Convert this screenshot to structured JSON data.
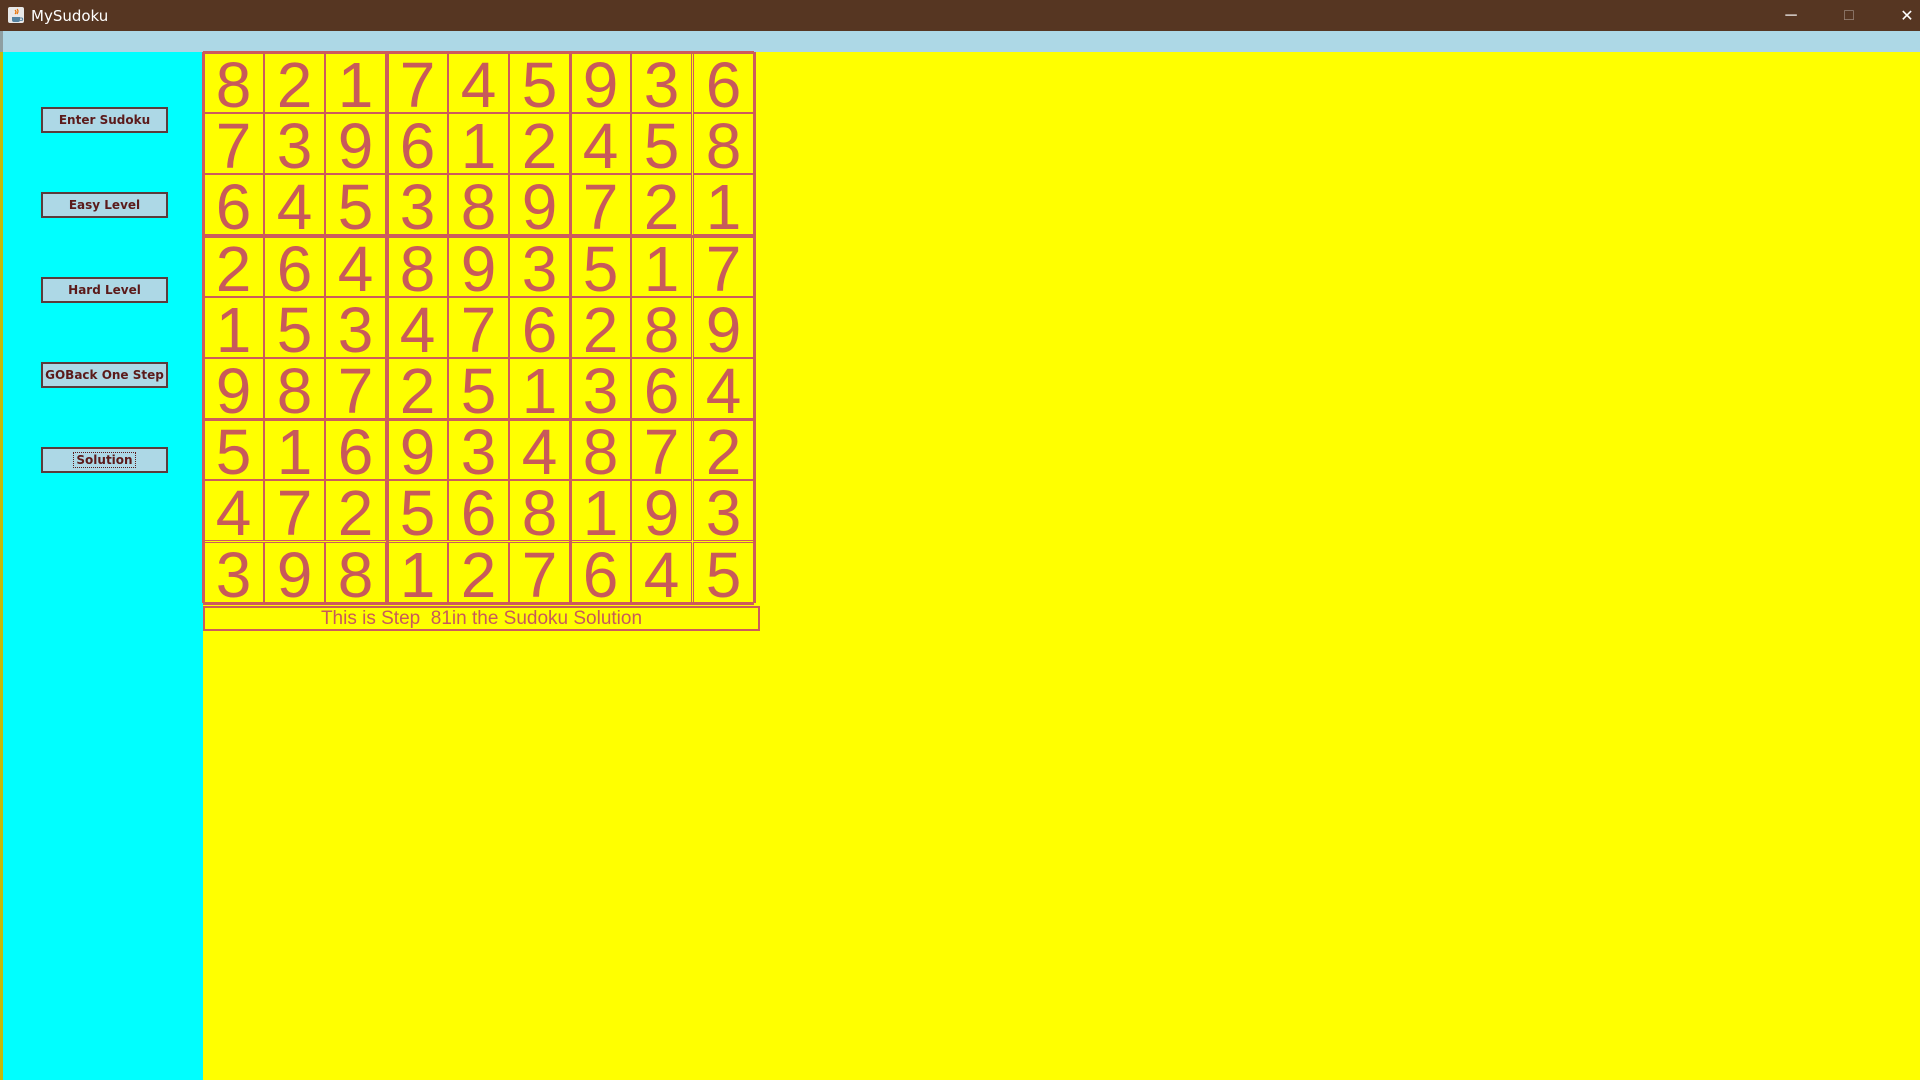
{
  "window": {
    "title": "MySudoku",
    "minimize_glyph": "─",
    "maximize_glyph": "□",
    "close_glyph": "✕",
    "titlebar_color": "#563622",
    "menubar_color": "#add8e6"
  },
  "sidebar": {
    "background": "#00ffff",
    "buttons": [
      {
        "label": "Enter Sudoku"
      },
      {
        "label": "Easy Level"
      },
      {
        "label": "Hard Level"
      },
      {
        "label": "GOBack One Step"
      },
      {
        "label": "Solution"
      }
    ]
  },
  "board": {
    "background": "#ffff00",
    "digit_color": "#c85a5a",
    "rows": [
      [
        "8",
        "2",
        "1",
        "7",
        "4",
        "5",
        "9",
        "3",
        "6"
      ],
      [
        "7",
        "3",
        "9",
        "6",
        "1",
        "2",
        "4",
        "5",
        "8"
      ],
      [
        "6",
        "4",
        "5",
        "3",
        "8",
        "9",
        "7",
        "2",
        "1"
      ],
      [
        "2",
        "6",
        "4",
        "8",
        "9",
        "3",
        "5",
        "1",
        "7"
      ],
      [
        "1",
        "5",
        "3",
        "4",
        "7",
        "6",
        "2",
        "8",
        "9"
      ],
      [
        "9",
        "8",
        "7",
        "2",
        "5",
        "1",
        "3",
        "6",
        "4"
      ],
      [
        "5",
        "1",
        "6",
        "9",
        "3",
        "4",
        "8",
        "7",
        "2"
      ],
      [
        "4",
        "7",
        "2",
        "5",
        "6",
        "8",
        "1",
        "9",
        "3"
      ],
      [
        "3",
        "9",
        "8",
        "1",
        "2",
        "7",
        "6",
        "4",
        "5"
      ]
    ]
  },
  "status": {
    "text": "This is Step  81in the Sudoku Solution"
  }
}
